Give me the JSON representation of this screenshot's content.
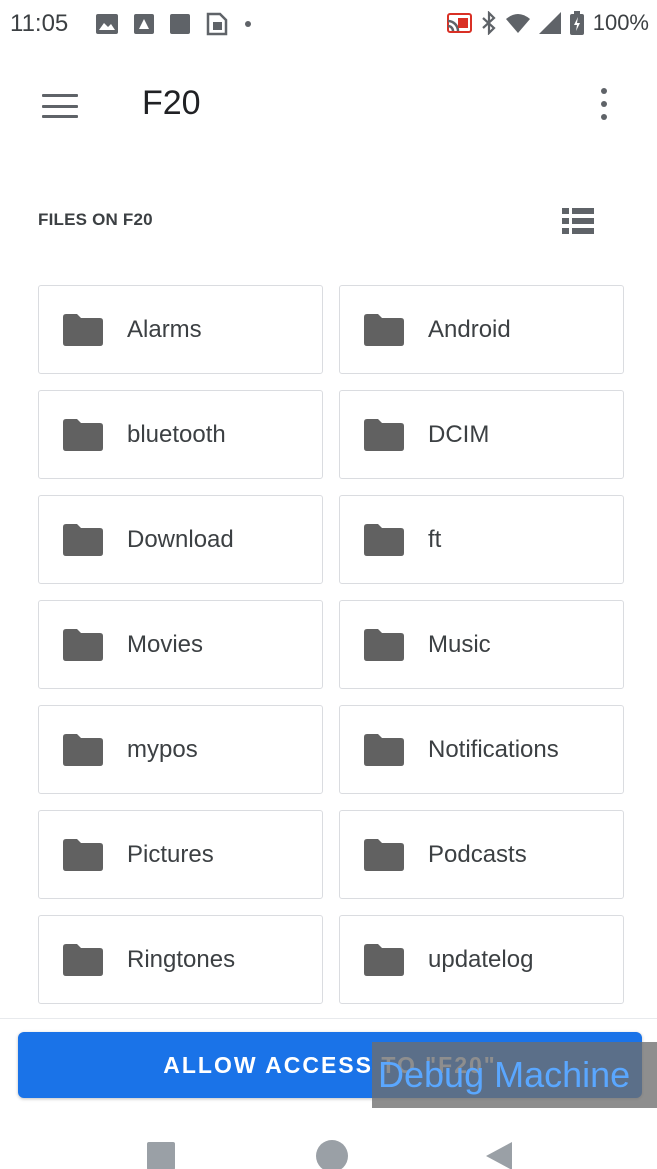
{
  "status_bar": {
    "time": "11:05",
    "battery": "100%",
    "left_icons": [
      "gallery-icon",
      "image-icon",
      "square-icon",
      "sim-toolkit-icon",
      "dot-icon"
    ],
    "right_icons": [
      "cast-icon",
      "bluetooth-icon",
      "wifi-icon",
      "signal-icon",
      "battery-icon"
    ]
  },
  "app_bar": {
    "title": "F20",
    "menu_icon": "hamburger-menu-icon",
    "overflow_icon": "more-vert-icon"
  },
  "section": {
    "header": "FILES ON F20",
    "view_toggle_icon": "list-view-icon"
  },
  "folders": [
    {
      "name": "Alarms"
    },
    {
      "name": "Android"
    },
    {
      "name": "bluetooth"
    },
    {
      "name": "DCIM"
    },
    {
      "name": "Download"
    },
    {
      "name": "ft"
    },
    {
      "name": "Movies"
    },
    {
      "name": "Music"
    },
    {
      "name": "mypos"
    },
    {
      "name": "Notifications"
    },
    {
      "name": "Pictures"
    },
    {
      "name": "Podcasts"
    },
    {
      "name": "Ringtones"
    },
    {
      "name": "updatelog"
    }
  ],
  "allow_button": {
    "label": "ALLOW ACCESS TO \"F20\""
  },
  "debug_overlay": {
    "text": "Debug Machine"
  },
  "nav_bar": {
    "icons": [
      "recents-icon",
      "home-icon",
      "back-icon"
    ]
  },
  "colors": {
    "accent": "#1a73e8",
    "folder_icon": "#616161",
    "tile_border": "#dadce0",
    "debug_text": "#5aa7ff"
  }
}
